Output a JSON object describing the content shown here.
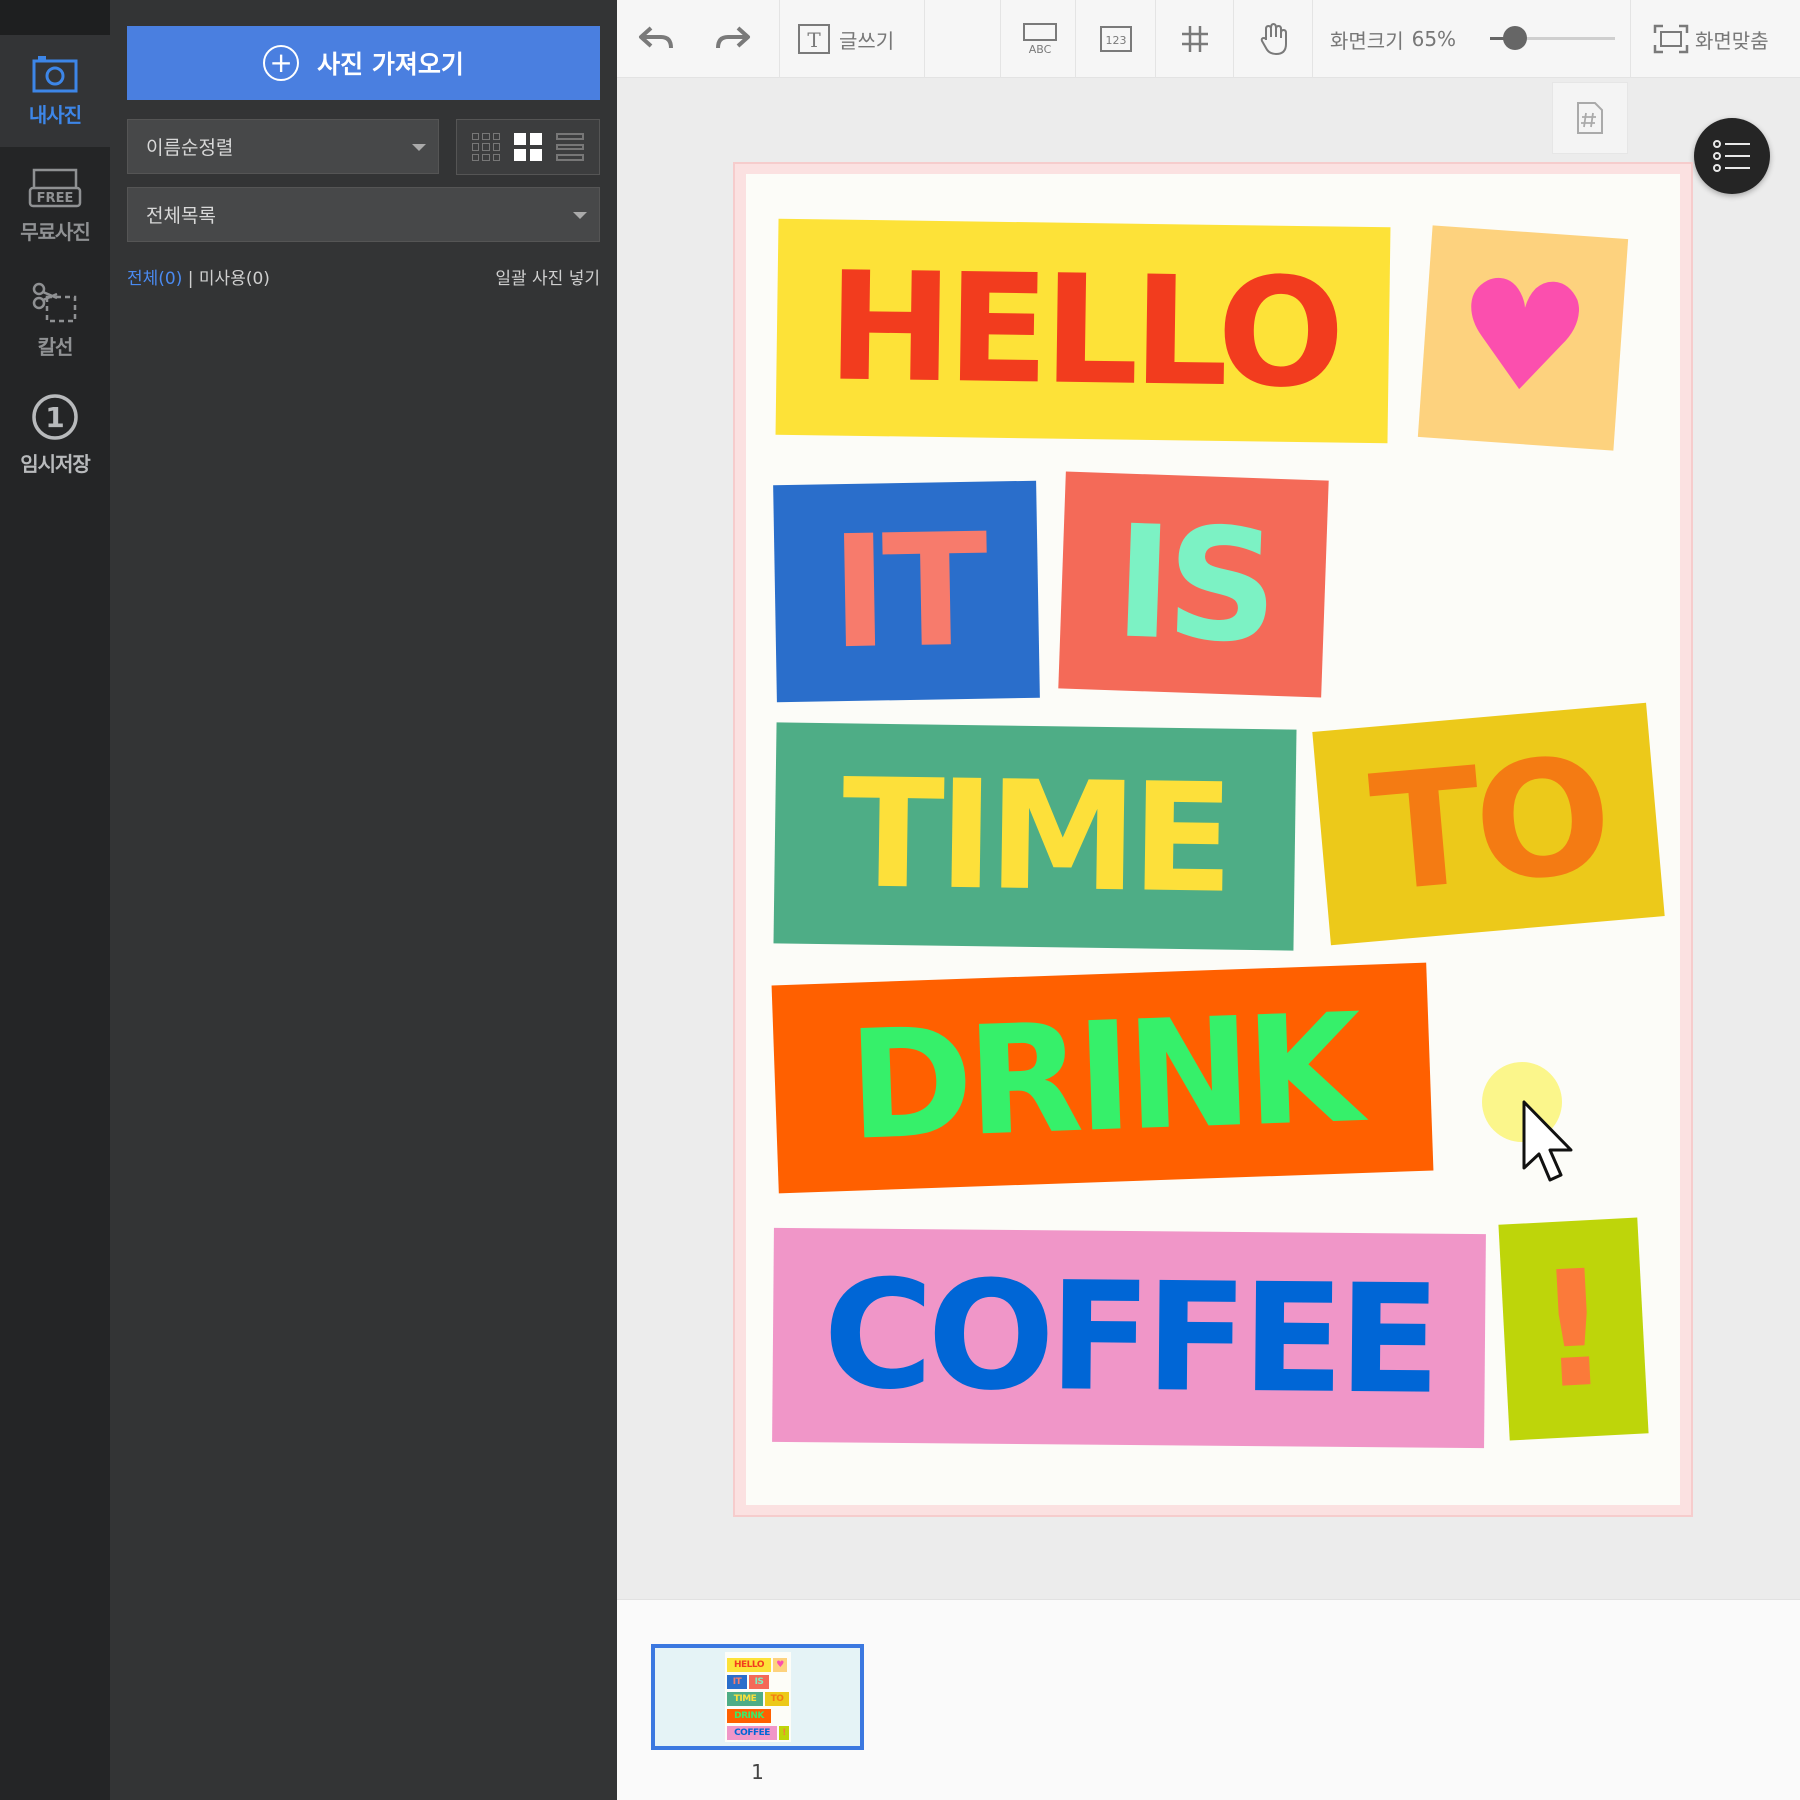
{
  "rail": {
    "items": [
      {
        "label": "내사진",
        "icon": "camera-icon",
        "active": true
      },
      {
        "label": "무료사진",
        "icon": "free-photo-icon",
        "active": false
      },
      {
        "label": "칼선",
        "icon": "scissors-icon",
        "active": false
      },
      {
        "label": "임시저장",
        "icon": "temp-save-icon",
        "badge": "1",
        "active": false
      }
    ]
  },
  "panel": {
    "import_label": "사진 가져오기",
    "sort_value": "이름순정렬",
    "list_value": "전체목록",
    "filter_all": "전체(0)",
    "filter_sep": "|",
    "filter_unused": "미사용(0)",
    "batch_label": "일괄 사진 넣기",
    "view_modes": [
      "grid-small",
      "grid-large",
      "list"
    ],
    "active_view": "grid-large"
  },
  "toolbar": {
    "text_label": "글쓰기",
    "abc_label": "ABC",
    "num_label": "123",
    "zoom_label": "화면크기",
    "zoom_value": "65%",
    "zoom_fraction": 0.2,
    "fit_label": "화면맞춤"
  },
  "design": {
    "words": [
      {
        "text": "HELLO",
        "bg": "#fde238",
        "fg": "#f23c1e"
      },
      {
        "text": "♥",
        "bg": "#fdd27e",
        "fg": "#fb4fae"
      },
      {
        "text": "IT",
        "bg": "#2a6ecb",
        "fg": "#f77b6c"
      },
      {
        "text": "IS",
        "bg": "#f46a58",
        "fg": "#7cf2c4"
      },
      {
        "text": "TIME",
        "bg": "#4ead86",
        "fg": "#fde03a"
      },
      {
        "text": "TO",
        "bg": "#ecc91a",
        "fg": "#f47b13"
      },
      {
        "text": "DRINK",
        "bg": "#ff6000",
        "fg": "#36f06a"
      },
      {
        "text": "COFFEE",
        "bg": "#f096c8",
        "fg": "#0066d6"
      },
      {
        "text": "!",
        "bg": "#bed50a",
        "fg": "#fb7a3a"
      }
    ]
  },
  "pages": {
    "items": [
      {
        "number": "1"
      }
    ]
  },
  "colors": {
    "accent": "#4a7fe0",
    "rail_bg": "#242526",
    "panel_bg": "#333435"
  }
}
